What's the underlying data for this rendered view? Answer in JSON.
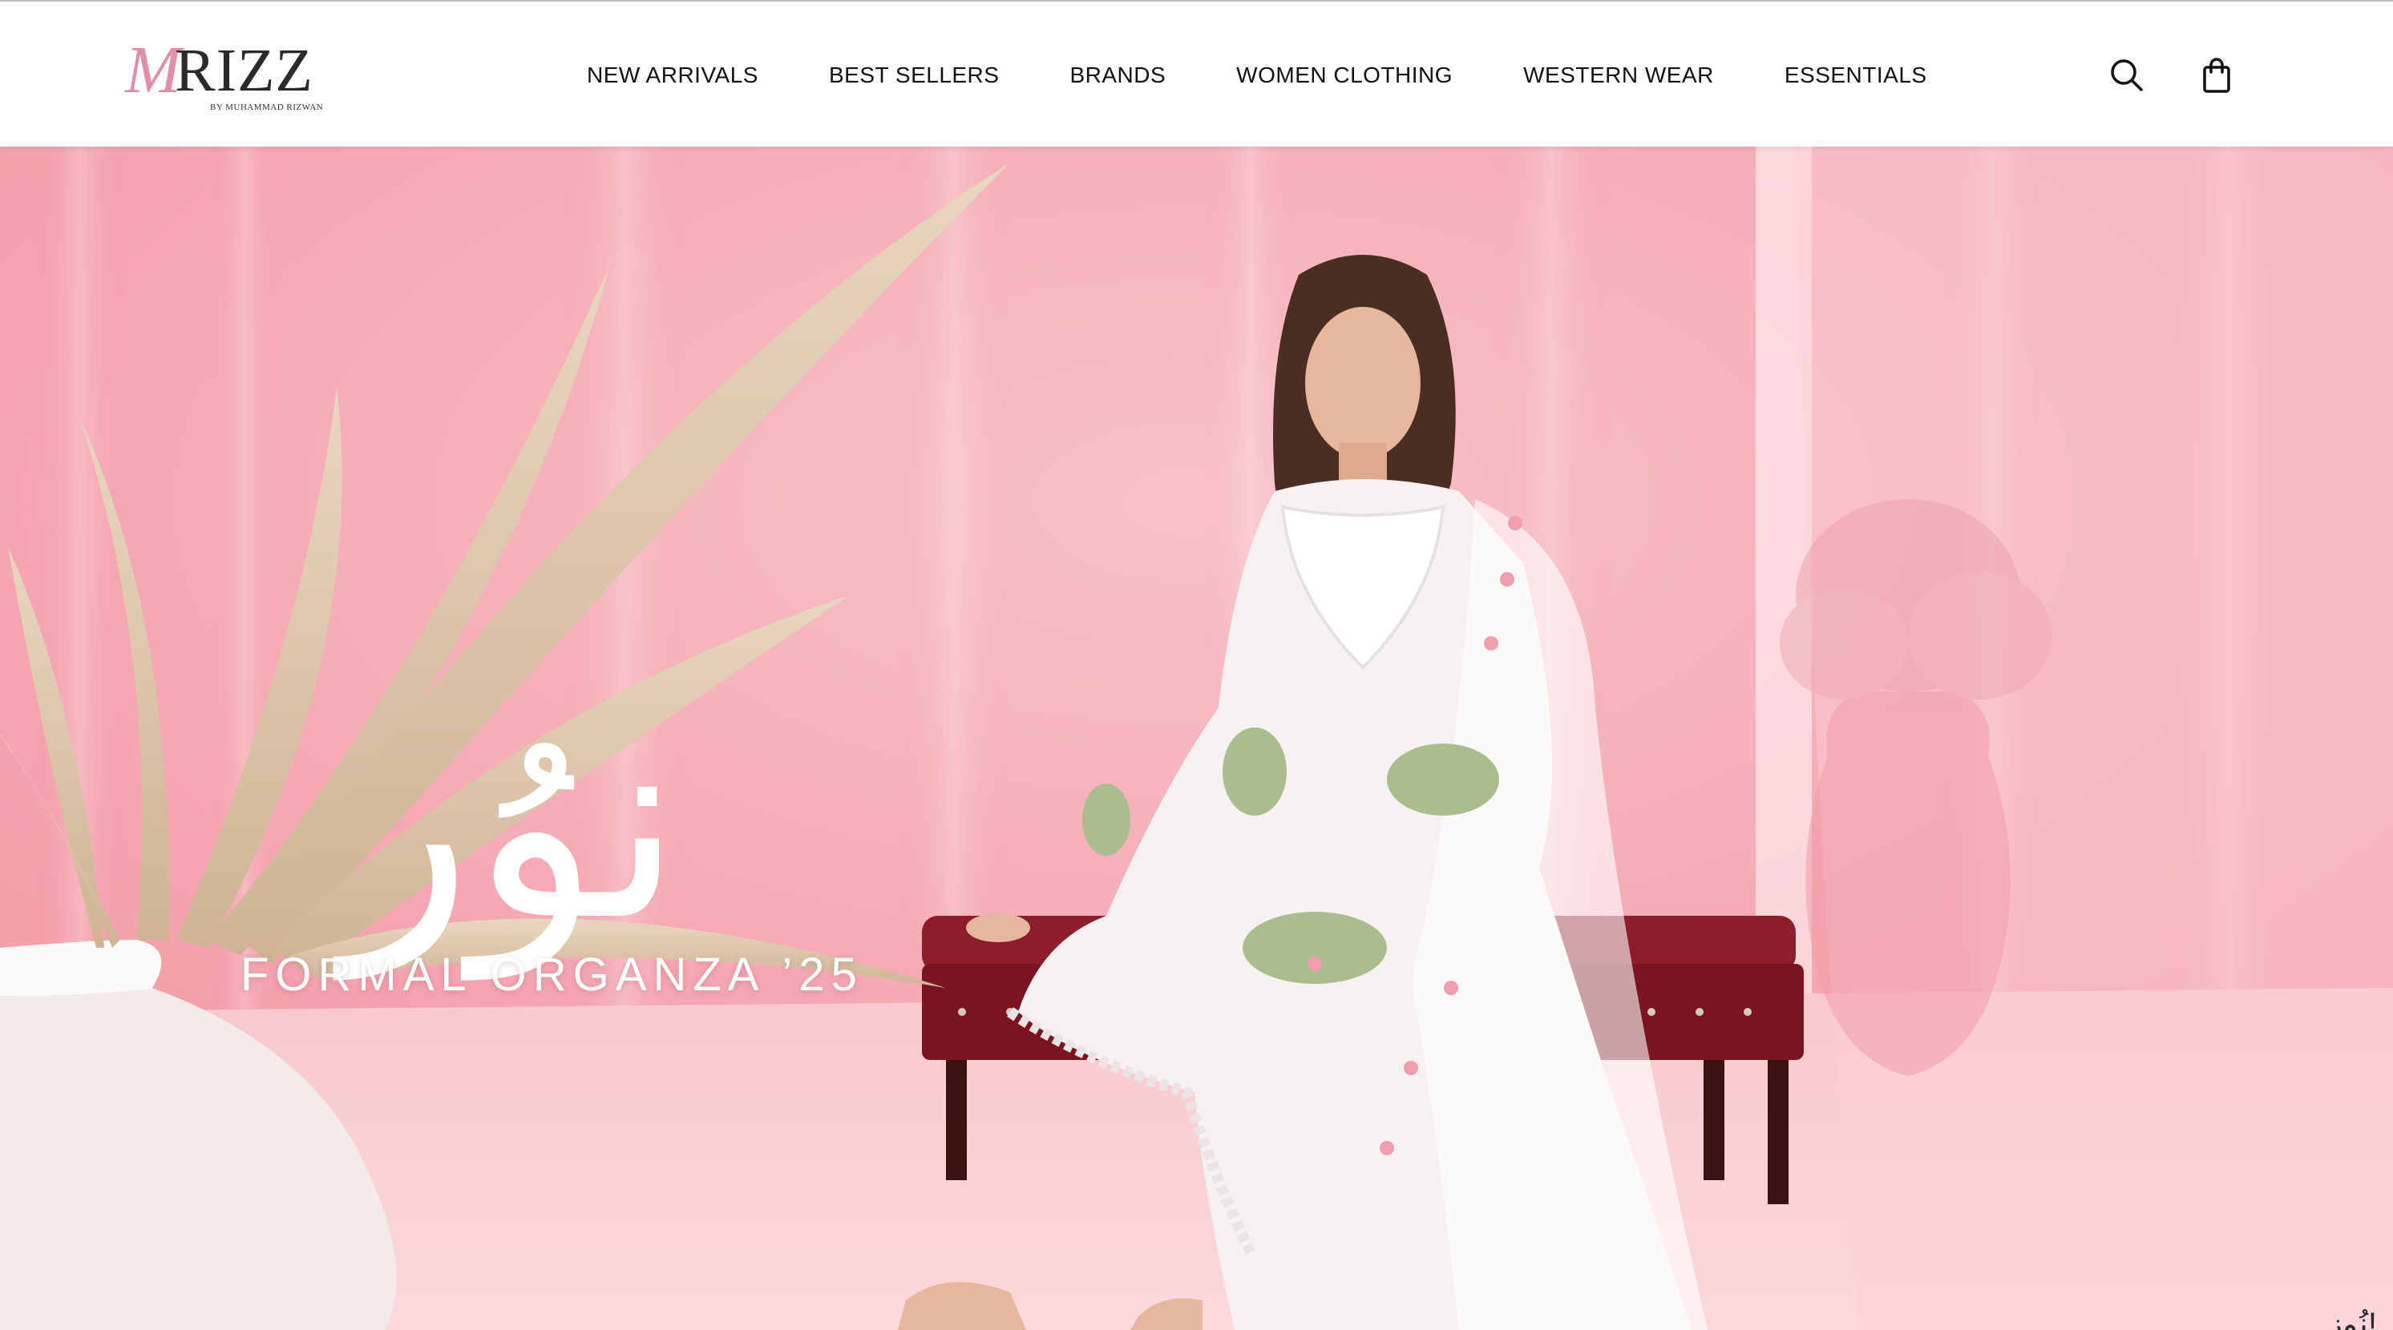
{
  "brand": {
    "logo_initial": "M",
    "logo_rest": "RIZZ",
    "logo_subtitle": "BY MUHAMMAD RIZWAN",
    "accent_color": "#e08fa9"
  },
  "nav": {
    "items": [
      {
        "label": "NEW ARRIVALS"
      },
      {
        "label": "BEST SELLERS"
      },
      {
        "label": "BRANDS"
      },
      {
        "label": "WOMEN CLOTHING"
      },
      {
        "label": "WESTERN WEAR"
      },
      {
        "label": "ESSENTIALS"
      }
    ]
  },
  "header_icons": {
    "search": "search-icon",
    "cart": "shopping-bag-icon"
  },
  "hero": {
    "calligraphy": "نوُر",
    "collection_title": "FORMAL ORGANZA ’25",
    "corner_text": "نُوزِ!",
    "background_color": "#f6a3ad"
  }
}
